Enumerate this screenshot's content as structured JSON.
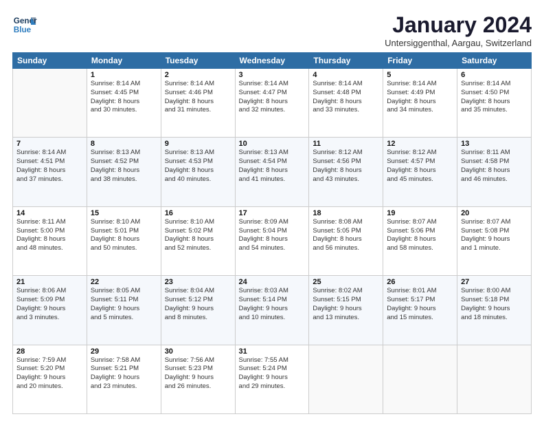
{
  "header": {
    "logo_line1": "General",
    "logo_line2": "Blue",
    "title": "January 2024",
    "location": "Untersiggenthal, Aargau, Switzerland"
  },
  "weekdays": [
    "Sunday",
    "Monday",
    "Tuesday",
    "Wednesday",
    "Thursday",
    "Friday",
    "Saturday"
  ],
  "weeks": [
    [
      {
        "day": "",
        "info": ""
      },
      {
        "day": "1",
        "info": "Sunrise: 8:14 AM\nSunset: 4:45 PM\nDaylight: 8 hours\nand 30 minutes."
      },
      {
        "day": "2",
        "info": "Sunrise: 8:14 AM\nSunset: 4:46 PM\nDaylight: 8 hours\nand 31 minutes."
      },
      {
        "day": "3",
        "info": "Sunrise: 8:14 AM\nSunset: 4:47 PM\nDaylight: 8 hours\nand 32 minutes."
      },
      {
        "day": "4",
        "info": "Sunrise: 8:14 AM\nSunset: 4:48 PM\nDaylight: 8 hours\nand 33 minutes."
      },
      {
        "day": "5",
        "info": "Sunrise: 8:14 AM\nSunset: 4:49 PM\nDaylight: 8 hours\nand 34 minutes."
      },
      {
        "day": "6",
        "info": "Sunrise: 8:14 AM\nSunset: 4:50 PM\nDaylight: 8 hours\nand 35 minutes."
      }
    ],
    [
      {
        "day": "7",
        "info": "Sunrise: 8:14 AM\nSunset: 4:51 PM\nDaylight: 8 hours\nand 37 minutes."
      },
      {
        "day": "8",
        "info": "Sunrise: 8:13 AM\nSunset: 4:52 PM\nDaylight: 8 hours\nand 38 minutes."
      },
      {
        "day": "9",
        "info": "Sunrise: 8:13 AM\nSunset: 4:53 PM\nDaylight: 8 hours\nand 40 minutes."
      },
      {
        "day": "10",
        "info": "Sunrise: 8:13 AM\nSunset: 4:54 PM\nDaylight: 8 hours\nand 41 minutes."
      },
      {
        "day": "11",
        "info": "Sunrise: 8:12 AM\nSunset: 4:56 PM\nDaylight: 8 hours\nand 43 minutes."
      },
      {
        "day": "12",
        "info": "Sunrise: 8:12 AM\nSunset: 4:57 PM\nDaylight: 8 hours\nand 45 minutes."
      },
      {
        "day": "13",
        "info": "Sunrise: 8:11 AM\nSunset: 4:58 PM\nDaylight: 8 hours\nand 46 minutes."
      }
    ],
    [
      {
        "day": "14",
        "info": "Sunrise: 8:11 AM\nSunset: 5:00 PM\nDaylight: 8 hours\nand 48 minutes."
      },
      {
        "day": "15",
        "info": "Sunrise: 8:10 AM\nSunset: 5:01 PM\nDaylight: 8 hours\nand 50 minutes."
      },
      {
        "day": "16",
        "info": "Sunrise: 8:10 AM\nSunset: 5:02 PM\nDaylight: 8 hours\nand 52 minutes."
      },
      {
        "day": "17",
        "info": "Sunrise: 8:09 AM\nSunset: 5:04 PM\nDaylight: 8 hours\nand 54 minutes."
      },
      {
        "day": "18",
        "info": "Sunrise: 8:08 AM\nSunset: 5:05 PM\nDaylight: 8 hours\nand 56 minutes."
      },
      {
        "day": "19",
        "info": "Sunrise: 8:07 AM\nSunset: 5:06 PM\nDaylight: 8 hours\nand 58 minutes."
      },
      {
        "day": "20",
        "info": "Sunrise: 8:07 AM\nSunset: 5:08 PM\nDaylight: 9 hours\nand 1 minute."
      }
    ],
    [
      {
        "day": "21",
        "info": "Sunrise: 8:06 AM\nSunset: 5:09 PM\nDaylight: 9 hours\nand 3 minutes."
      },
      {
        "day": "22",
        "info": "Sunrise: 8:05 AM\nSunset: 5:11 PM\nDaylight: 9 hours\nand 5 minutes."
      },
      {
        "day": "23",
        "info": "Sunrise: 8:04 AM\nSunset: 5:12 PM\nDaylight: 9 hours\nand 8 minutes."
      },
      {
        "day": "24",
        "info": "Sunrise: 8:03 AM\nSunset: 5:14 PM\nDaylight: 9 hours\nand 10 minutes."
      },
      {
        "day": "25",
        "info": "Sunrise: 8:02 AM\nSunset: 5:15 PM\nDaylight: 9 hours\nand 13 minutes."
      },
      {
        "day": "26",
        "info": "Sunrise: 8:01 AM\nSunset: 5:17 PM\nDaylight: 9 hours\nand 15 minutes."
      },
      {
        "day": "27",
        "info": "Sunrise: 8:00 AM\nSunset: 5:18 PM\nDaylight: 9 hours\nand 18 minutes."
      }
    ],
    [
      {
        "day": "28",
        "info": "Sunrise: 7:59 AM\nSunset: 5:20 PM\nDaylight: 9 hours\nand 20 minutes."
      },
      {
        "day": "29",
        "info": "Sunrise: 7:58 AM\nSunset: 5:21 PM\nDaylight: 9 hours\nand 23 minutes."
      },
      {
        "day": "30",
        "info": "Sunrise: 7:56 AM\nSunset: 5:23 PM\nDaylight: 9 hours\nand 26 minutes."
      },
      {
        "day": "31",
        "info": "Sunrise: 7:55 AM\nSunset: 5:24 PM\nDaylight: 9 hours\nand 29 minutes."
      },
      {
        "day": "",
        "info": ""
      },
      {
        "day": "",
        "info": ""
      },
      {
        "day": "",
        "info": ""
      }
    ]
  ]
}
